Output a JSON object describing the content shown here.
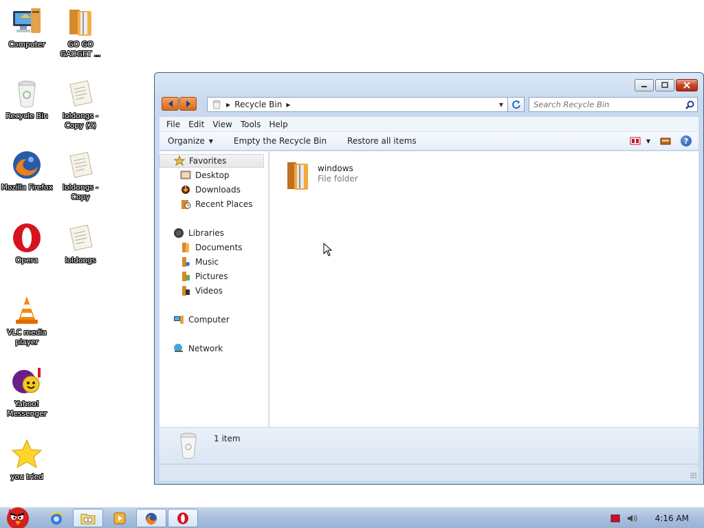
{
  "desktop": {
    "icons": [
      {
        "label": "Computer"
      },
      {
        "label": "GO GO GADGET ..."
      },
      {
        "label": "Recycle Bin"
      },
      {
        "label": "loldongs - Copy (2)"
      },
      {
        "label": "Mozilla Firefox"
      },
      {
        "label": "loldongs - Copy"
      },
      {
        "label": "Opera"
      },
      {
        "label": "loldongs"
      },
      {
        "label": "VLC media player"
      },
      {
        "label": "Yahoo! Messenger"
      },
      {
        "label": "you tried"
      }
    ]
  },
  "window": {
    "address": {
      "crumb": "Recycle Bin"
    },
    "search": {
      "placeholder": "Search Recycle Bin"
    },
    "menu": [
      "File",
      "Edit",
      "View",
      "Tools",
      "Help"
    ],
    "toolbar": {
      "organize": "Organize",
      "empty": "Empty the Recycle Bin",
      "restore": "Restore all items"
    },
    "nav": {
      "favorites": "Favorites",
      "desktop": "Desktop",
      "downloads": "Downloads",
      "recent": "Recent Places",
      "libraries": "Libraries",
      "documents": "Documents",
      "music": "Music",
      "pictures": "Pictures",
      "videos": "Videos",
      "computer": "Computer",
      "network": "Network"
    },
    "items": [
      {
        "name": "windows",
        "type": "File folder"
      }
    ],
    "details": {
      "count": "1 item"
    }
  },
  "taskbar": {
    "clock": "4:16 AM"
  },
  "colors": {
    "accent": "#3e5f85",
    "nav_orange": "#e07a2c",
    "taskbar": "#a9c0de"
  }
}
